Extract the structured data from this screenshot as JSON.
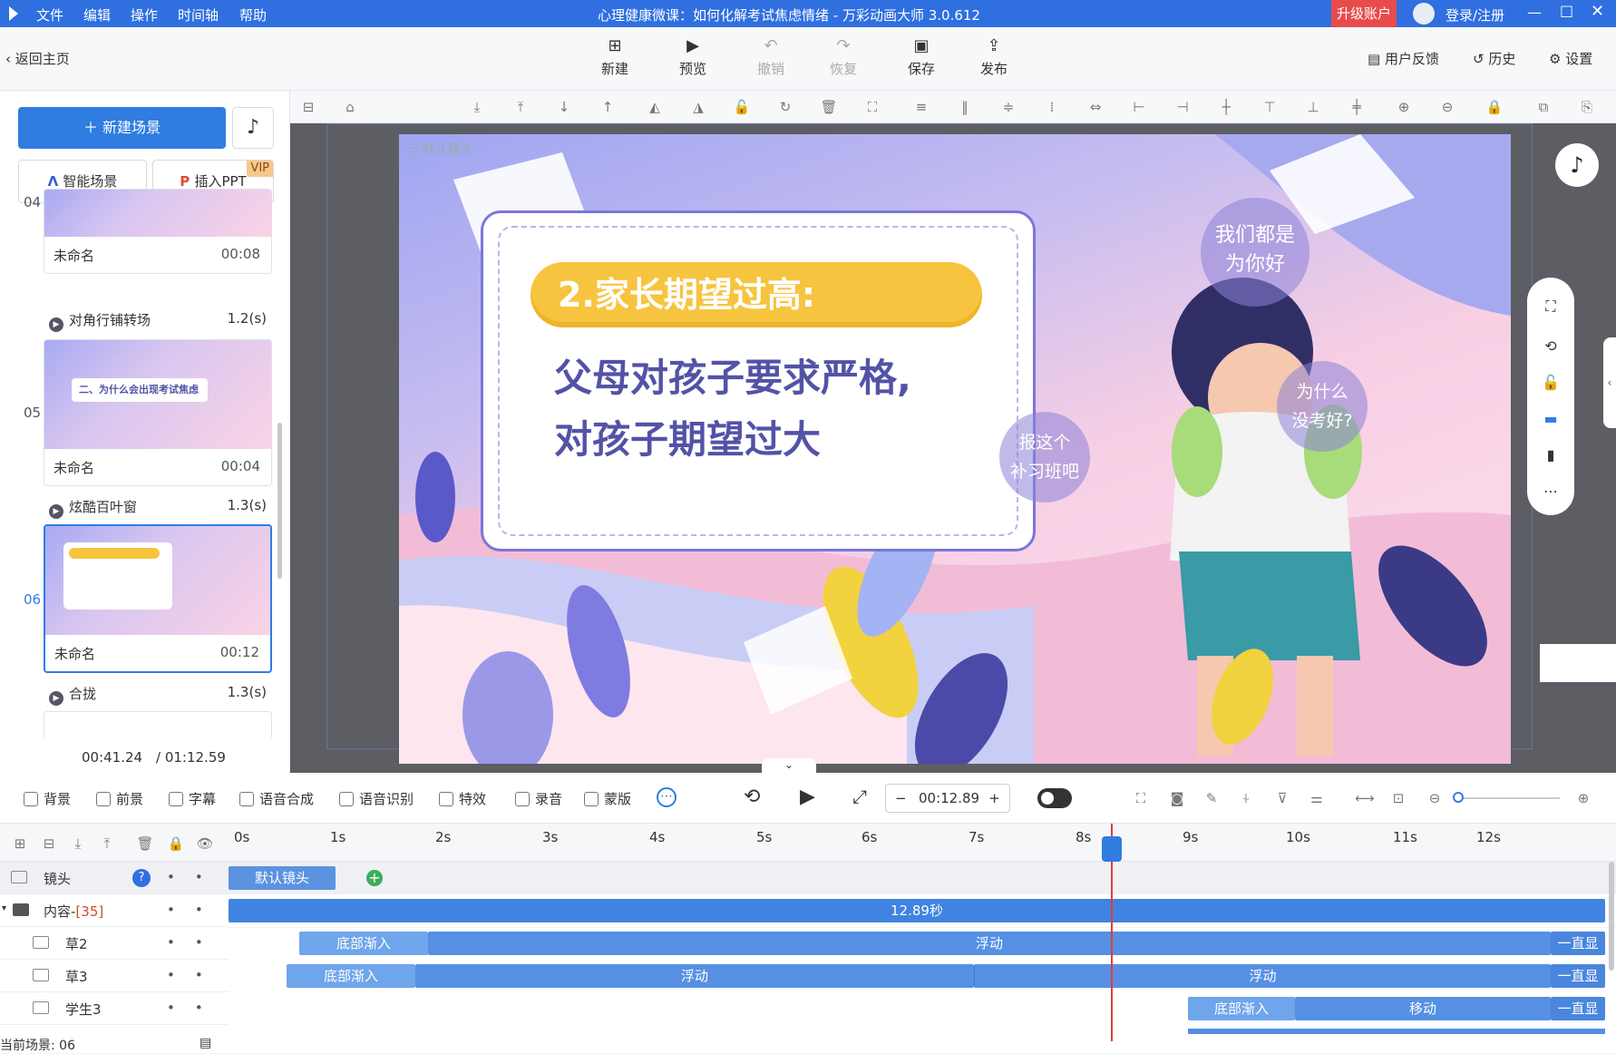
{
  "titlebar": {
    "menu": [
      "文件",
      "编辑",
      "操作",
      "时间轴",
      "帮助"
    ],
    "title": "心理健康微课：如何化解考试焦虑情绪 - 万彩动画大师 3.0.612",
    "upgrade": "升级账户",
    "login": "登录/注册"
  },
  "toolbar": {
    "back": "返回主页",
    "new": "新建",
    "preview": "预览",
    "undo": "撤销",
    "redo": "恢复",
    "save": "保存",
    "publish": "发布",
    "feedback": "用户反馈",
    "history": "历史",
    "settings": "设置"
  },
  "left": {
    "new_scene": "新建场景",
    "smart_scene": "智能场景",
    "insert_ppt": "插入PPT",
    "vip": "VIP",
    "scenes": [
      {
        "num": "04",
        "name": "未命名",
        "time": "00:08",
        "transition": "对角行铺转场",
        "trans_time": "1.2(s)"
      },
      {
        "num": "05",
        "name": "未命名",
        "time": "00:04",
        "transition": "炫酷百叶窗",
        "trans_time": "1.3(s)",
        "thumb_title": "二、为什么会出现考试焦虑"
      },
      {
        "num": "06",
        "name": "未命名",
        "time": "00:12",
        "transition": "合拢",
        "trans_time": "1.3(s)"
      }
    ],
    "current_time": "00:41.24",
    "total_time": "/ 01:12.59"
  },
  "stage": {
    "camera_label": "默认镜头",
    "heading": "2.家长期望过高:",
    "line1": "父母对孩子要求严格,",
    "line2": "对孩子期望过大",
    "bubble1a": "我们都是",
    "bubble1b": "为你好",
    "bubble2a": "为什么",
    "bubble2b": "没考好?",
    "bubble3a": "报这个",
    "bubble3b": "补习班吧"
  },
  "tools": {
    "background": "背景",
    "foreground": "前景",
    "subtitle": "字幕",
    "tts": "语音合成",
    "asr": "语音识别",
    "effects": "特效",
    "record": "录音",
    "mask": "蒙版",
    "time": "00:12.89",
    "minus": "−",
    "plus": "+"
  },
  "timeline": {
    "ticks": [
      "0s",
      "1s",
      "2s",
      "3s",
      "4s",
      "5s",
      "6s",
      "7s",
      "8s",
      "9s",
      "10s",
      "11s",
      "12s"
    ],
    "tracks": [
      {
        "label": "镜头"
      },
      {
        "label": "内容-",
        "count": "[35]"
      },
      {
        "label": "草2"
      },
      {
        "label": "草3"
      },
      {
        "label": "学生3"
      }
    ],
    "camera_bar": "默认镜头",
    "content_bar": "12.89秒",
    "enter_bottom": "底部渐入",
    "float": "浮动",
    "always": "一直显",
    "move": "移动",
    "current_scene": "当前场景: 06"
  }
}
